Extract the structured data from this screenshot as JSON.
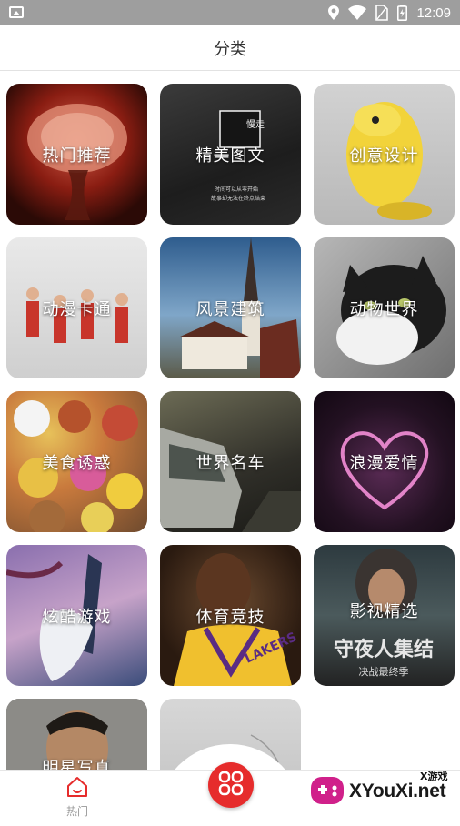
{
  "status_bar": {
    "time": "12:09"
  },
  "header": {
    "title": "分类"
  },
  "categories": [
    {
      "label": "热门推荐"
    },
    {
      "label": "精美图文"
    },
    {
      "label": "创意设计"
    },
    {
      "label": "动漫卡通"
    },
    {
      "label": "风景建筑"
    },
    {
      "label": "动物世界"
    },
    {
      "label": "美食诱惑"
    },
    {
      "label": "世界名车"
    },
    {
      "label": "浪漫爱情"
    },
    {
      "label": "炫酷游戏"
    },
    {
      "label": "体育竞技"
    },
    {
      "label": "影视精选"
    },
    {
      "label": "明星写真"
    },
    {
      "label": ""
    }
  ],
  "tile_texts": {
    "pic_sign": "慢走",
    "pic_caption_1": "时间可以从零开始",
    "pic_caption_2": "故事却无法在终点结束",
    "movie_title": "守夜人集结",
    "movie_sub": "决战最终季",
    "sport_jersey": "LAKERS"
  },
  "bottom_nav": {
    "hot_label": "热门"
  },
  "watermark": {
    "sub": "X游戏",
    "main": "XYouXi.net"
  },
  "colors": {
    "accent": "#e62c2c",
    "status_bar": "#9e9e9e"
  }
}
